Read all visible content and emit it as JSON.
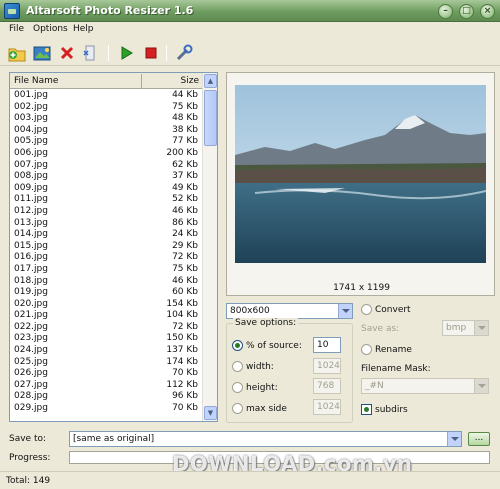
{
  "window": {
    "title": "Altarsoft Photo Resizer 1.6"
  },
  "menu": [
    "File",
    "Options",
    "Help"
  ],
  "file_list": {
    "col_name": "File Name",
    "col_size": "Size",
    "rows": [
      {
        "name": "001.jpg",
        "size": "44 Kb"
      },
      {
        "name": "002.jpg",
        "size": "75 Kb"
      },
      {
        "name": "003.jpg",
        "size": "48 Kb"
      },
      {
        "name": "004.jpg",
        "size": "38 Kb"
      },
      {
        "name": "005.jpg",
        "size": "77 Kb"
      },
      {
        "name": "006.jpg",
        "size": "200 Kb"
      },
      {
        "name": "007.jpg",
        "size": "62 Kb"
      },
      {
        "name": "008.jpg",
        "size": "37 Kb"
      },
      {
        "name": "009.jpg",
        "size": "49 Kb"
      },
      {
        "name": "011.jpg",
        "size": "52 Kb"
      },
      {
        "name": "012.jpg",
        "size": "46 Kb"
      },
      {
        "name": "013.jpg",
        "size": "86 Kb"
      },
      {
        "name": "014.jpg",
        "size": "24 Kb"
      },
      {
        "name": "015.jpg",
        "size": "29 Kb"
      },
      {
        "name": "016.jpg",
        "size": "72 Kb"
      },
      {
        "name": "017.jpg",
        "size": "75 Kb"
      },
      {
        "name": "018.jpg",
        "size": "46 Kb"
      },
      {
        "name": "019.jpg",
        "size": "60 Kb"
      },
      {
        "name": "020.jpg",
        "size": "154 Kb"
      },
      {
        "name": "021.jpg",
        "size": "104 Kb"
      },
      {
        "name": "022.jpg",
        "size": "72 Kb"
      },
      {
        "name": "023.jpg",
        "size": "150 Kb"
      },
      {
        "name": "024.jpg",
        "size": "137 Kb"
      },
      {
        "name": "025.jpg",
        "size": "174 Kb"
      },
      {
        "name": "026.jpg",
        "size": "70 Kb"
      },
      {
        "name": "027.jpg",
        "size": "112 Kb"
      },
      {
        "name": "028.jpg",
        "size": "96 Kb"
      },
      {
        "name": "029.jpg",
        "size": "70 Kb"
      }
    ]
  },
  "preview": {
    "dimensions": "1741 x 1199"
  },
  "size_preset": "800x600",
  "save_options": {
    "label": "Save options:",
    "percent_label": "% of source:",
    "percent_value": "10",
    "width_label": "width:",
    "width_value": "1024",
    "height_label": "height:",
    "height_value": "768",
    "maxside_label": "max side",
    "maxside_value": "1024"
  },
  "convert": {
    "label": "Convert",
    "save_as_label": "Save as:",
    "format": "bmp"
  },
  "rename": {
    "label": "Rename",
    "mask_label": "Filename Mask:",
    "mask_value": "_#N"
  },
  "subdirs_label": "subdirs",
  "save_to": {
    "label": "Save to:",
    "value": "[same as original]",
    "browse": "..."
  },
  "progress": {
    "label": "Progress:",
    "percent": 0
  },
  "status": {
    "total": "Total: 149"
  },
  "watermark": "DOWNLOAD.com.vn",
  "colors": {
    "titlebar": "#6f9d60",
    "window_bg": "#ece9d8",
    "accent_green": "#2a7a2a"
  },
  "toolbar_icons": [
    "add-files-icon",
    "add-folder-icon",
    "remove-icon",
    "clear-icon",
    "start-icon",
    "stop-icon",
    "settings-icon"
  ]
}
